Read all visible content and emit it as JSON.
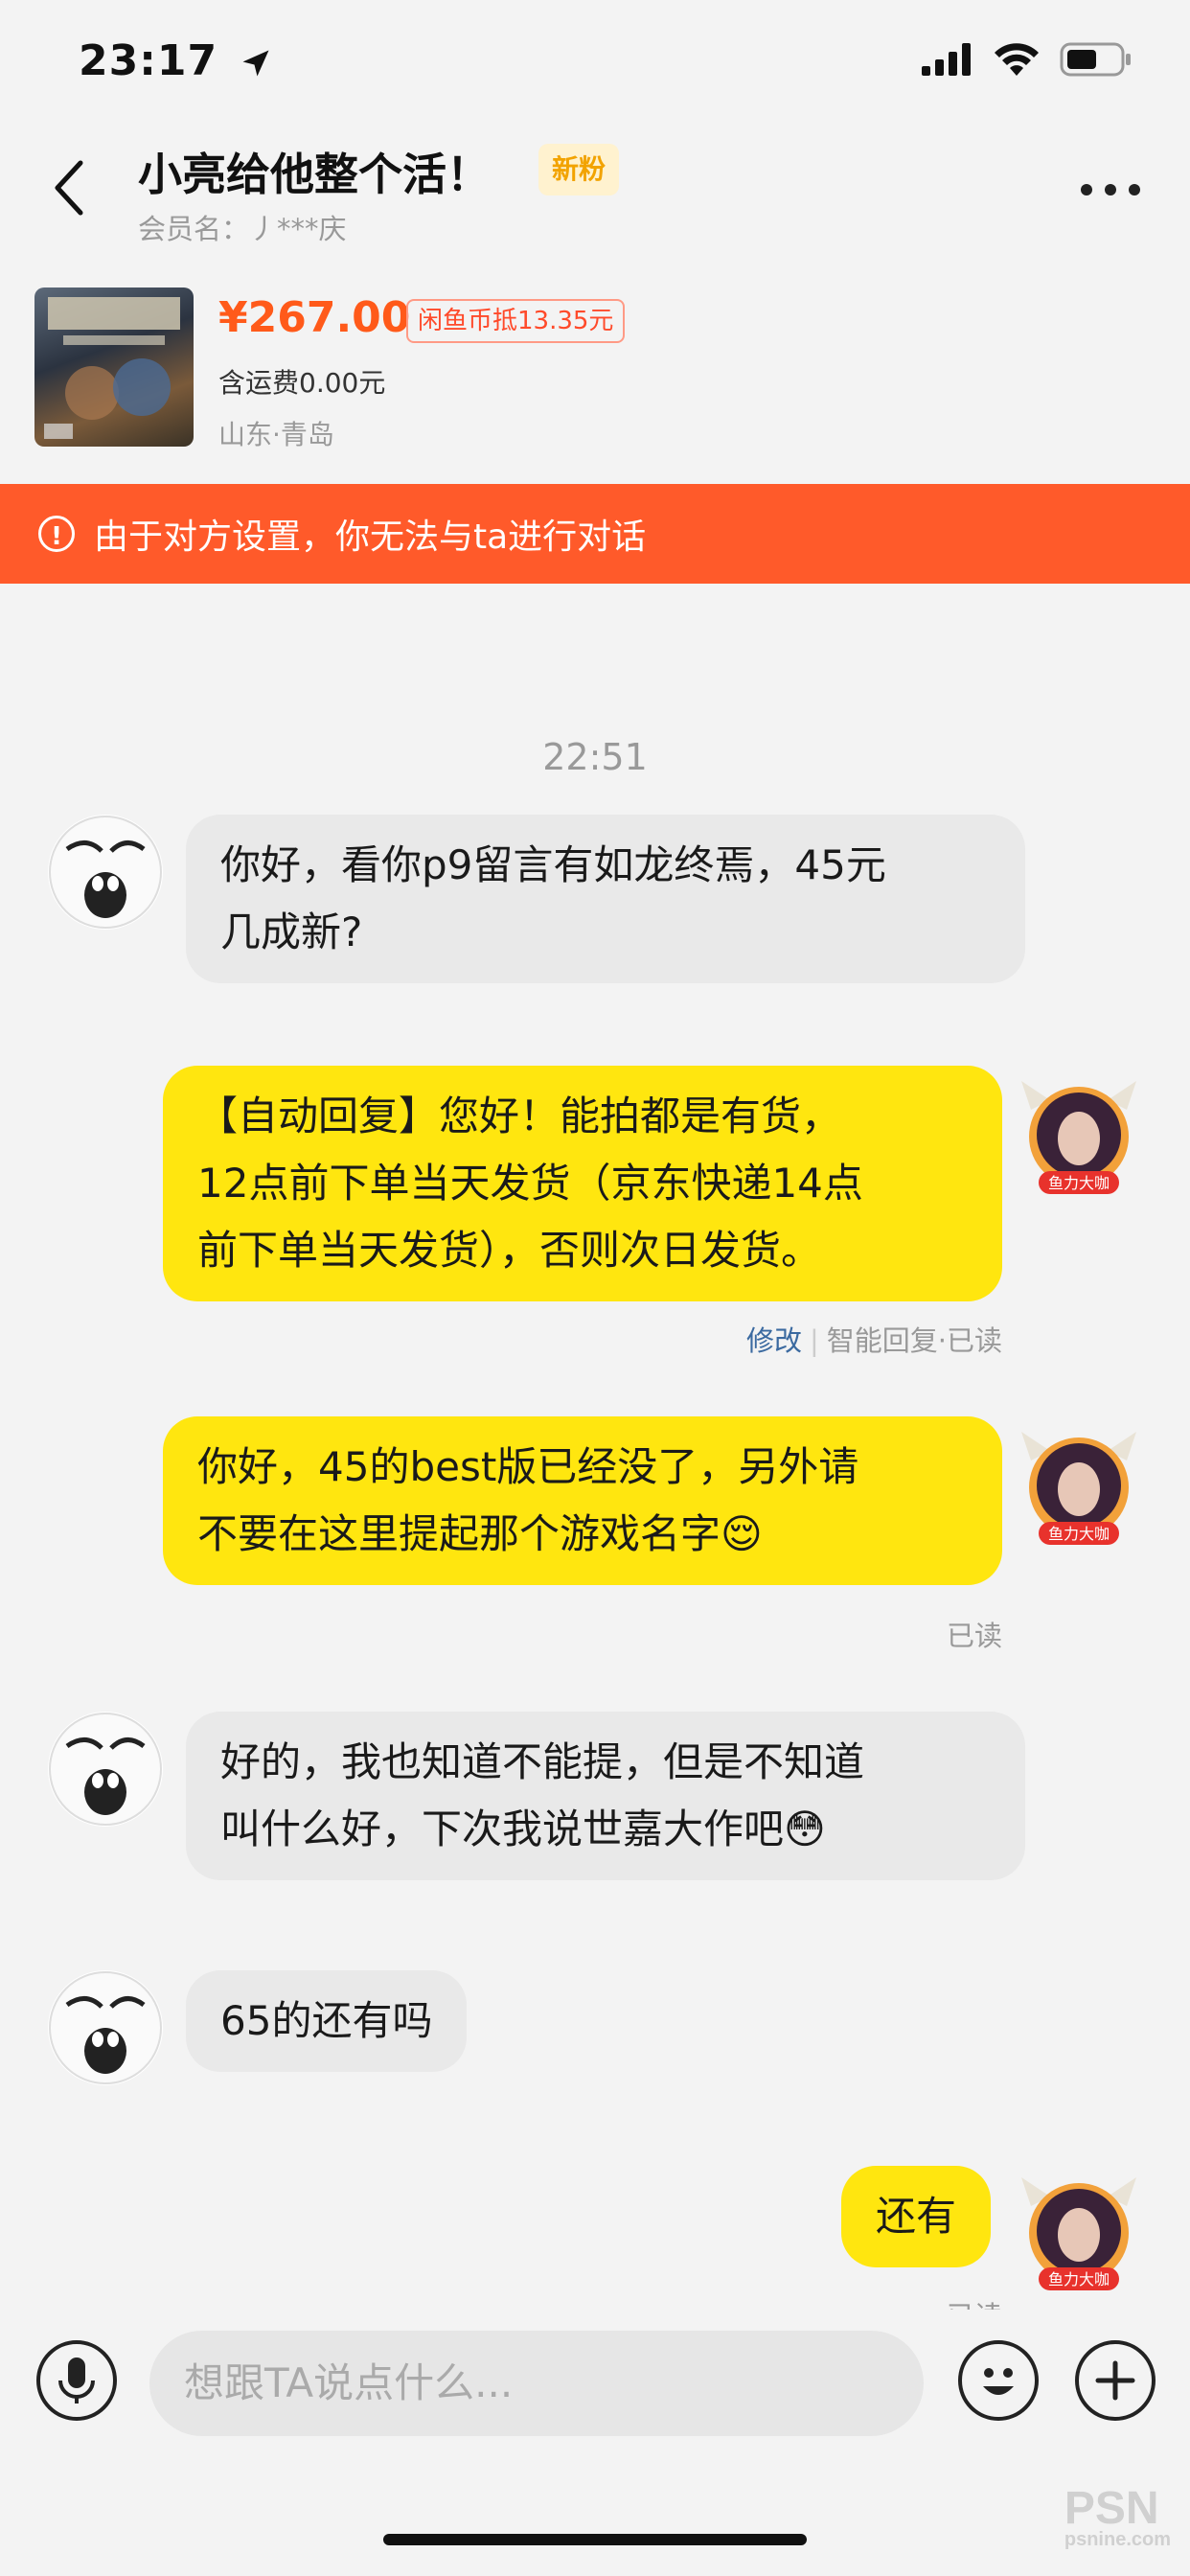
{
  "status_bar": {
    "time": "23:17"
  },
  "header": {
    "title": "小亮给他整个活！",
    "badge": "新粉",
    "member_name": "会员名：丿***庆"
  },
  "product": {
    "price": "¥267.00",
    "coin_deduct": "闲鱼币抵13.35元",
    "shipping": "含运费0.00元",
    "location": "山东·青岛"
  },
  "banner": {
    "icon": "!",
    "text": "由于对方设置，你无法与ta进行对话"
  },
  "chat": {
    "timestamp": "22:51",
    "messages": [
      {
        "side": "left",
        "text_line1": "你好，看你p9留言有如龙终焉，45元",
        "text_line2": "几成新?"
      },
      {
        "side": "right",
        "text_line1": "【自动回复】您好！能拍都是有货，",
        "text_line2": "12点前下单当天发货（京东快递14点",
        "text_line3": "前下单当天发货），否则次日发货。",
        "meta_edit": "修改",
        "meta_status": "智能回复·已读"
      },
      {
        "side": "right",
        "text_line1": "你好，45的best版已经没了，另外请",
        "text_line2": "不要在这里提起那个游戏名字",
        "emoji": "😌",
        "meta_status": "已读"
      },
      {
        "side": "left",
        "text_line1": "好的，我也知道不能提，但是不知道",
        "text_line2": "叫什么好，下次我说世嘉大作吧",
        "emoji": "😳"
      },
      {
        "side": "left",
        "text_line1": "65的还有吗"
      },
      {
        "side": "right",
        "text_line1": "还有",
        "meta_status": "已读"
      }
    ]
  },
  "input_bar": {
    "placeholder": "想跟TA说点什么..."
  },
  "watermark": {
    "brand": "PSN",
    "sub": "psnine.com"
  },
  "colors": {
    "accent": "#ff5a2a",
    "bubble_self": "#ffe60f",
    "bubble_other": "#e9e9e9",
    "price": "#ff5a1a"
  }
}
